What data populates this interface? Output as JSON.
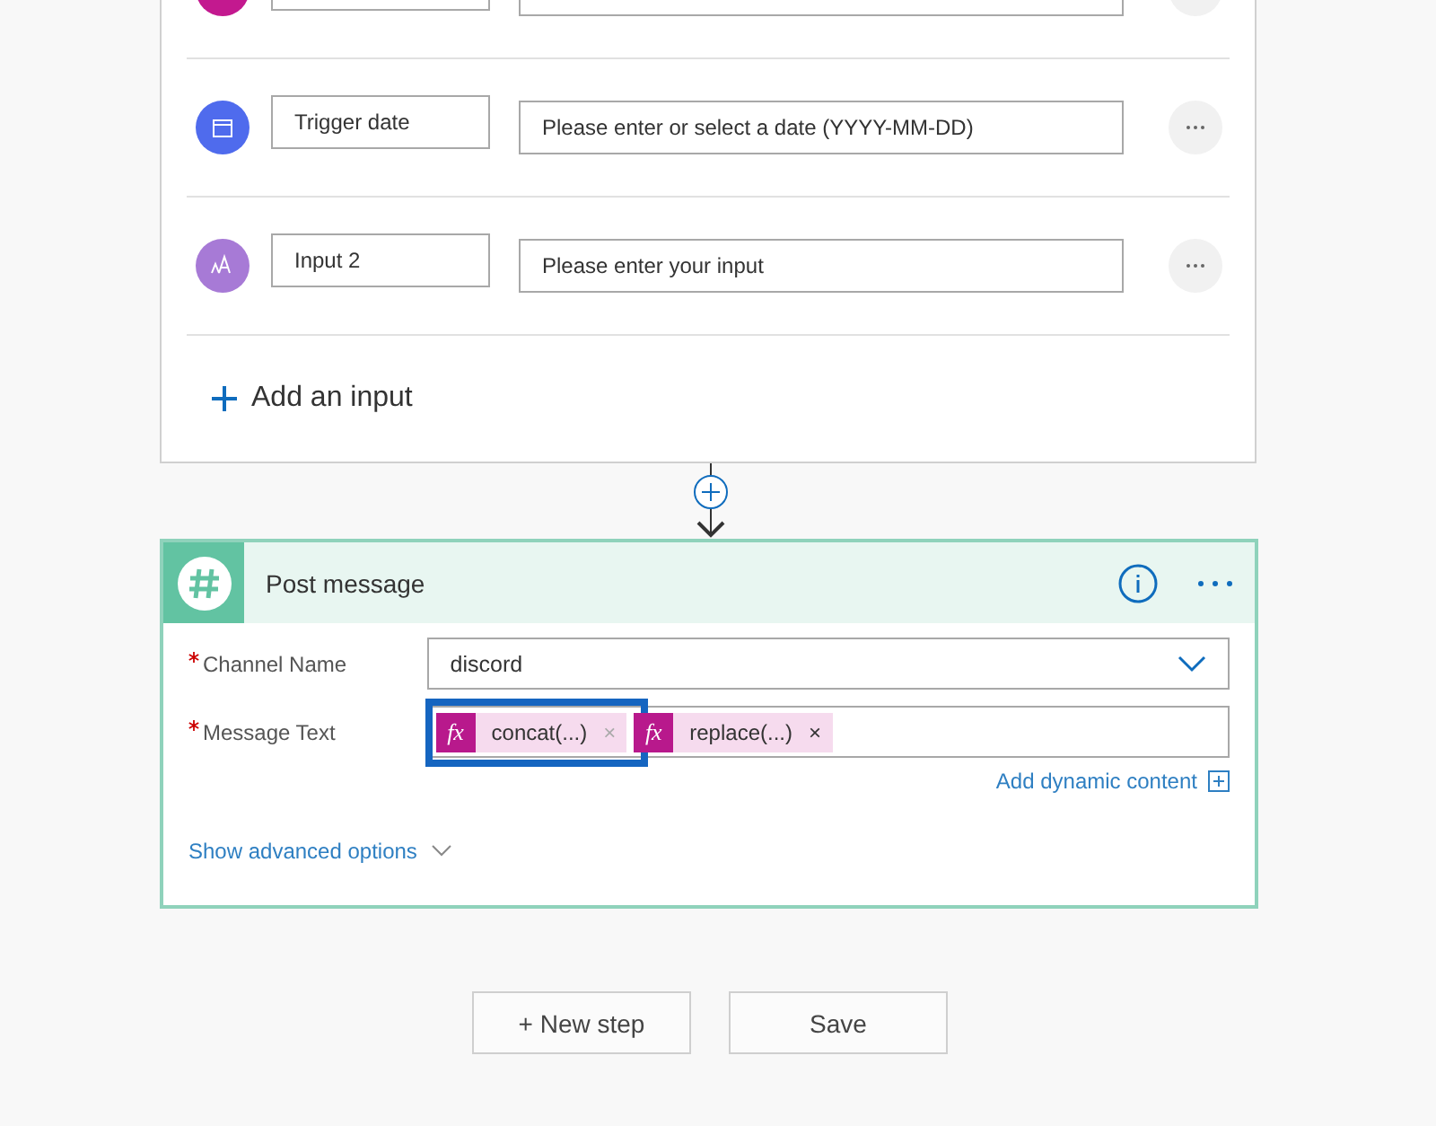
{
  "inputs": [
    {
      "kind": "file"
    },
    {
      "kind": "date",
      "label": "Trigger date",
      "placeholder": "Please enter or select a date (YYYY-MM-DD)"
    },
    {
      "kind": "text",
      "label": "Input 2",
      "placeholder": "Please enter your input"
    }
  ],
  "add_input": "Add an input",
  "action": {
    "title": "Post message",
    "fields": [
      {
        "kind": "dropdown",
        "label": "Channel Name",
        "required": true,
        "value": "discord"
      },
      {
        "kind": "tokens",
        "label": "Message Text",
        "required": true,
        "tokens": [
          {
            "icon": "fx",
            "text": "concat(...)",
            "remove": "×",
            "selected": true
          },
          {
            "icon": "fx",
            "text": "replace(...)",
            "remove": "×",
            "selected": false
          }
        ]
      }
    ],
    "dynamic_content": "Add dynamic content",
    "advanced": "Show advanced options"
  },
  "buttons": [
    "+ New step",
    "Save"
  ]
}
